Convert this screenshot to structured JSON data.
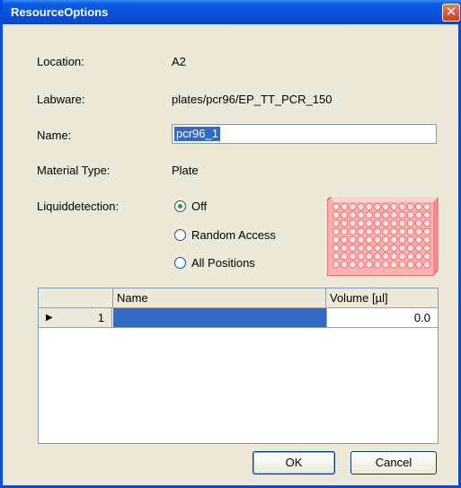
{
  "window": {
    "title": "ResourceOptions"
  },
  "fields": {
    "location_label": "Location:",
    "location_value": "A2",
    "labware_label": "Labware:",
    "labware_value": "plates/pcr96/EP_TT_PCR_150",
    "name_label": "Name:",
    "name_value": "pcr96_1",
    "material_label": "Material Type:",
    "material_value": "Plate",
    "liquid_label": "Liquiddetection:"
  },
  "liquiddetection": {
    "options": [
      "Off",
      "Random Access",
      "All Positions"
    ],
    "selected": "Off"
  },
  "grid": {
    "columns": [
      "Name",
      "Volume [µl]"
    ],
    "rows": [
      {
        "index": "1",
        "name": "",
        "volume": "0.0"
      }
    ]
  },
  "buttons": {
    "ok": "OK",
    "cancel": "Cancel"
  },
  "colors": {
    "titlebar": "#0a4fd8",
    "selection": "#316ac5",
    "plate": "#ff8a8a"
  }
}
